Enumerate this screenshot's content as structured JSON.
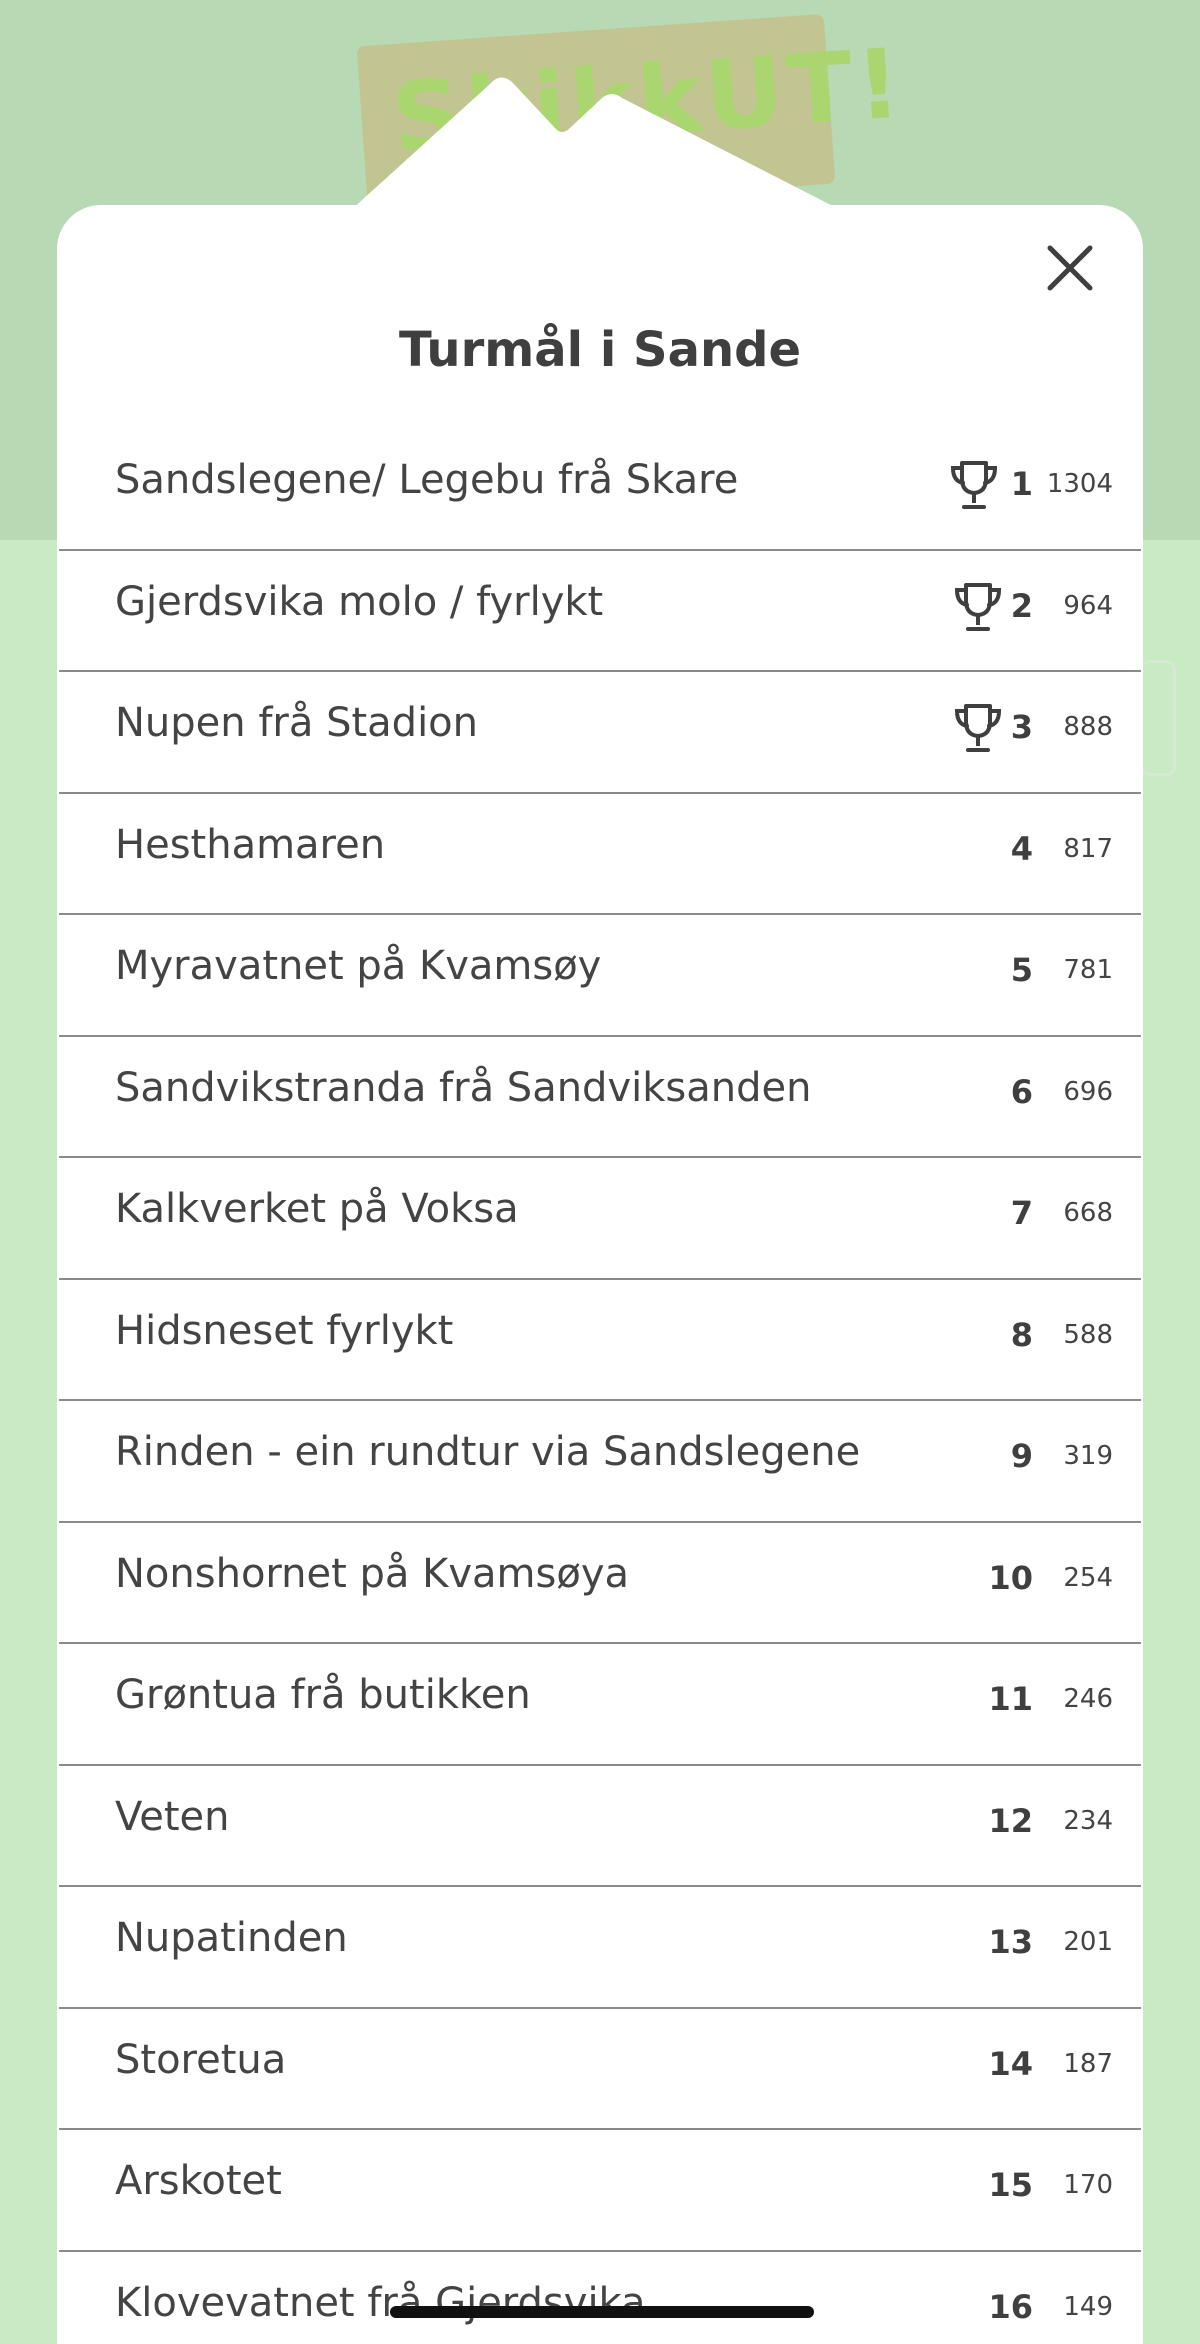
{
  "background": {
    "sign_text": "SkikkUT!"
  },
  "modal": {
    "title": "Turmål i Sande"
  },
  "rows": [
    {
      "name": "Sandslegene/ Legebu frå Skare",
      "rank": "1",
      "count": "1304",
      "trophy": true
    },
    {
      "name": "Gjerdsvika molo / fyrlykt",
      "rank": "2",
      "count": "964",
      "trophy": true
    },
    {
      "name": "Nupen frå Stadion",
      "rank": "3",
      "count": "888",
      "trophy": true
    },
    {
      "name": "Hesthamaren",
      "rank": "4",
      "count": "817",
      "trophy": false
    },
    {
      "name": "Myravatnet på Kvamsøy",
      "rank": "5",
      "count": "781",
      "trophy": false
    },
    {
      "name": "Sandvikstranda frå Sandviksanden",
      "rank": "6",
      "count": "696",
      "trophy": false
    },
    {
      "name": "Kalkverket på Voksa",
      "rank": "7",
      "count": "668",
      "trophy": false
    },
    {
      "name": "Hidsneset fyrlykt",
      "rank": "8",
      "count": "588",
      "trophy": false
    },
    {
      "name": "Rinden - ein rundtur via Sandslegene",
      "rank": "9",
      "count": "319",
      "trophy": false
    },
    {
      "name": "Nonshornet på Kvamsøya",
      "rank": "10",
      "count": "254",
      "trophy": false
    },
    {
      "name": "Grøntua frå butikken",
      "rank": "11",
      "count": "246",
      "trophy": false
    },
    {
      "name": "Veten",
      "rank": "12",
      "count": "234",
      "trophy": false
    },
    {
      "name": "Nupatinden",
      "rank": "13",
      "count": "201",
      "trophy": false
    },
    {
      "name": "Storetua",
      "rank": "14",
      "count": "187",
      "trophy": false
    },
    {
      "name": "Arskotet",
      "rank": "15",
      "count": "170",
      "trophy": false
    },
    {
      "name": "Klovevatnet frå Gjerdsvika",
      "rank": "16",
      "count": "149",
      "trophy": false
    }
  ],
  "icons": {
    "close": "close-icon",
    "trophy": "trophy-icon"
  },
  "colors": {
    "background": "#b7d9b4",
    "text": "#444444",
    "divider": "#8b8b8b"
  }
}
